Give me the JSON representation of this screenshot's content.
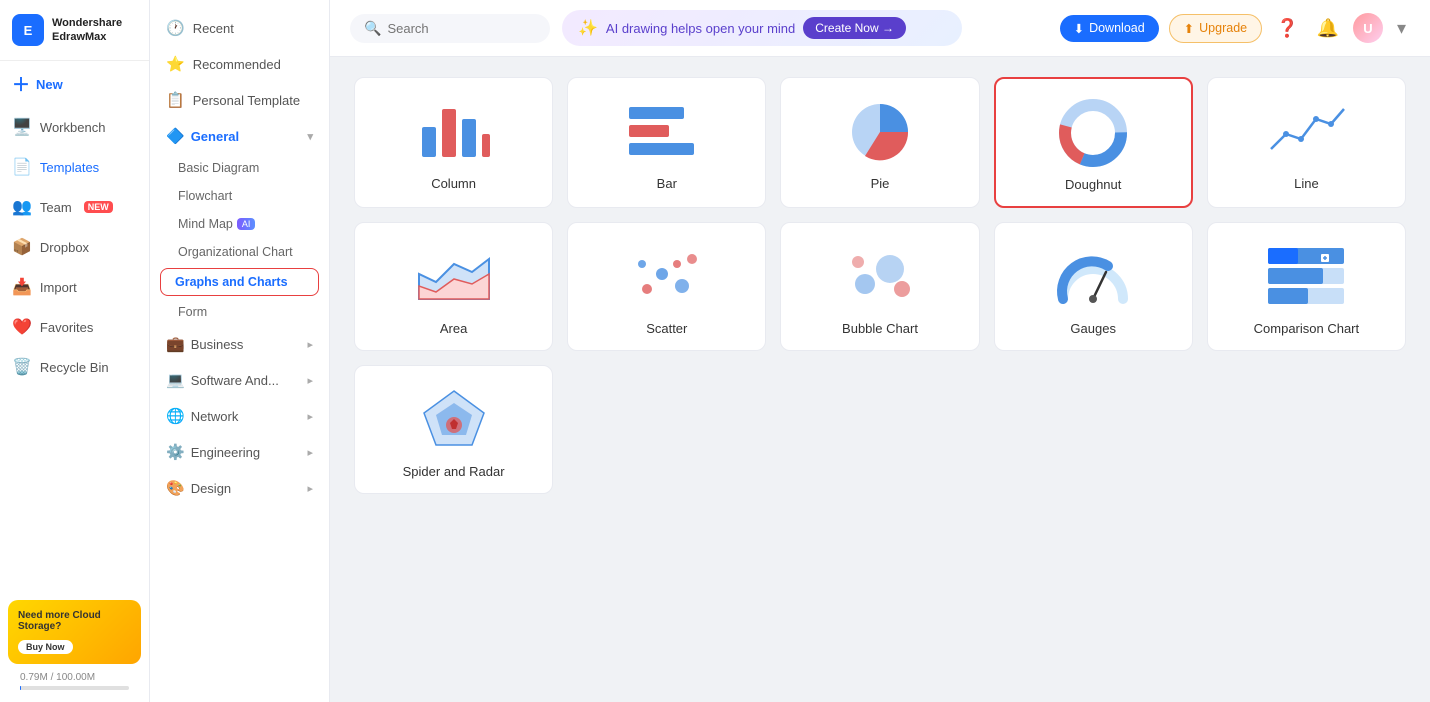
{
  "app": {
    "name": "EdrawMax",
    "brand": "Wondershare",
    "logo_letters": "E"
  },
  "left_nav": {
    "new_label": "New",
    "items": [
      {
        "id": "workbench",
        "label": "Workbench",
        "icon": "🖥️"
      },
      {
        "id": "templates",
        "label": "Templates",
        "icon": "📄"
      },
      {
        "id": "team",
        "label": "Team",
        "icon": "👥",
        "badge": "NEW"
      },
      {
        "id": "dropbox",
        "label": "Dropbox",
        "icon": "📦"
      },
      {
        "id": "import",
        "label": "Import",
        "icon": "📥"
      },
      {
        "id": "favorites",
        "label": "Favorites",
        "icon": "❤️"
      },
      {
        "id": "recycle",
        "label": "Recycle Bin",
        "icon": "🗑️"
      }
    ]
  },
  "cloud_promo": {
    "text": "Need more Cloud Storage?",
    "buy_label": "Buy Now"
  },
  "storage": {
    "label": "0.79M / 100.00M",
    "percent": 0.79
  },
  "mid_nav": {
    "recent_label": "Recent",
    "recommended_label": "Recommended",
    "personal_template_label": "Personal Template",
    "categories": [
      {
        "id": "general",
        "label": "General",
        "expanded": true,
        "items": [
          {
            "id": "basic-diagram",
            "label": "Basic Diagram"
          },
          {
            "id": "flowchart",
            "label": "Flowchart"
          },
          {
            "id": "mind-map",
            "label": "Mind Map",
            "ai": true
          },
          {
            "id": "org-chart",
            "label": "Organizational Chart"
          },
          {
            "id": "graphs-charts",
            "label": "Graphs and Charts",
            "active": true
          },
          {
            "id": "form",
            "label": "Form"
          }
        ]
      },
      {
        "id": "business",
        "label": "Business",
        "expanded": false
      },
      {
        "id": "software",
        "label": "Software And...",
        "expanded": false
      },
      {
        "id": "network",
        "label": "Network",
        "expanded": false
      },
      {
        "id": "engineering",
        "label": "Engineering",
        "expanded": false
      },
      {
        "id": "design",
        "label": "Design",
        "expanded": false
      }
    ]
  },
  "topbar": {
    "search_placeholder": "Search",
    "ai_banner_text": "AI drawing helps open your mind",
    "ai_create_label": "Create Now →",
    "download_label": "Download",
    "upgrade_label": "Upgrade"
  },
  "charts": [
    {
      "id": "column",
      "label": "Column",
      "type": "column"
    },
    {
      "id": "bar",
      "label": "Bar",
      "type": "bar"
    },
    {
      "id": "pie",
      "label": "Pie",
      "type": "pie"
    },
    {
      "id": "doughnut",
      "label": "Doughnut",
      "type": "doughnut",
      "selected": true
    },
    {
      "id": "line",
      "label": "Line",
      "type": "line"
    },
    {
      "id": "area",
      "label": "Area",
      "type": "area"
    },
    {
      "id": "scatter",
      "label": "Scatter",
      "type": "scatter"
    },
    {
      "id": "bubble",
      "label": "Bubble Chart",
      "type": "bubble"
    },
    {
      "id": "gauges",
      "label": "Gauges",
      "type": "gauges"
    },
    {
      "id": "comparison",
      "label": "Comparison Chart",
      "type": "comparison"
    },
    {
      "id": "spider",
      "label": "Spider and Radar",
      "type": "spider"
    }
  ]
}
